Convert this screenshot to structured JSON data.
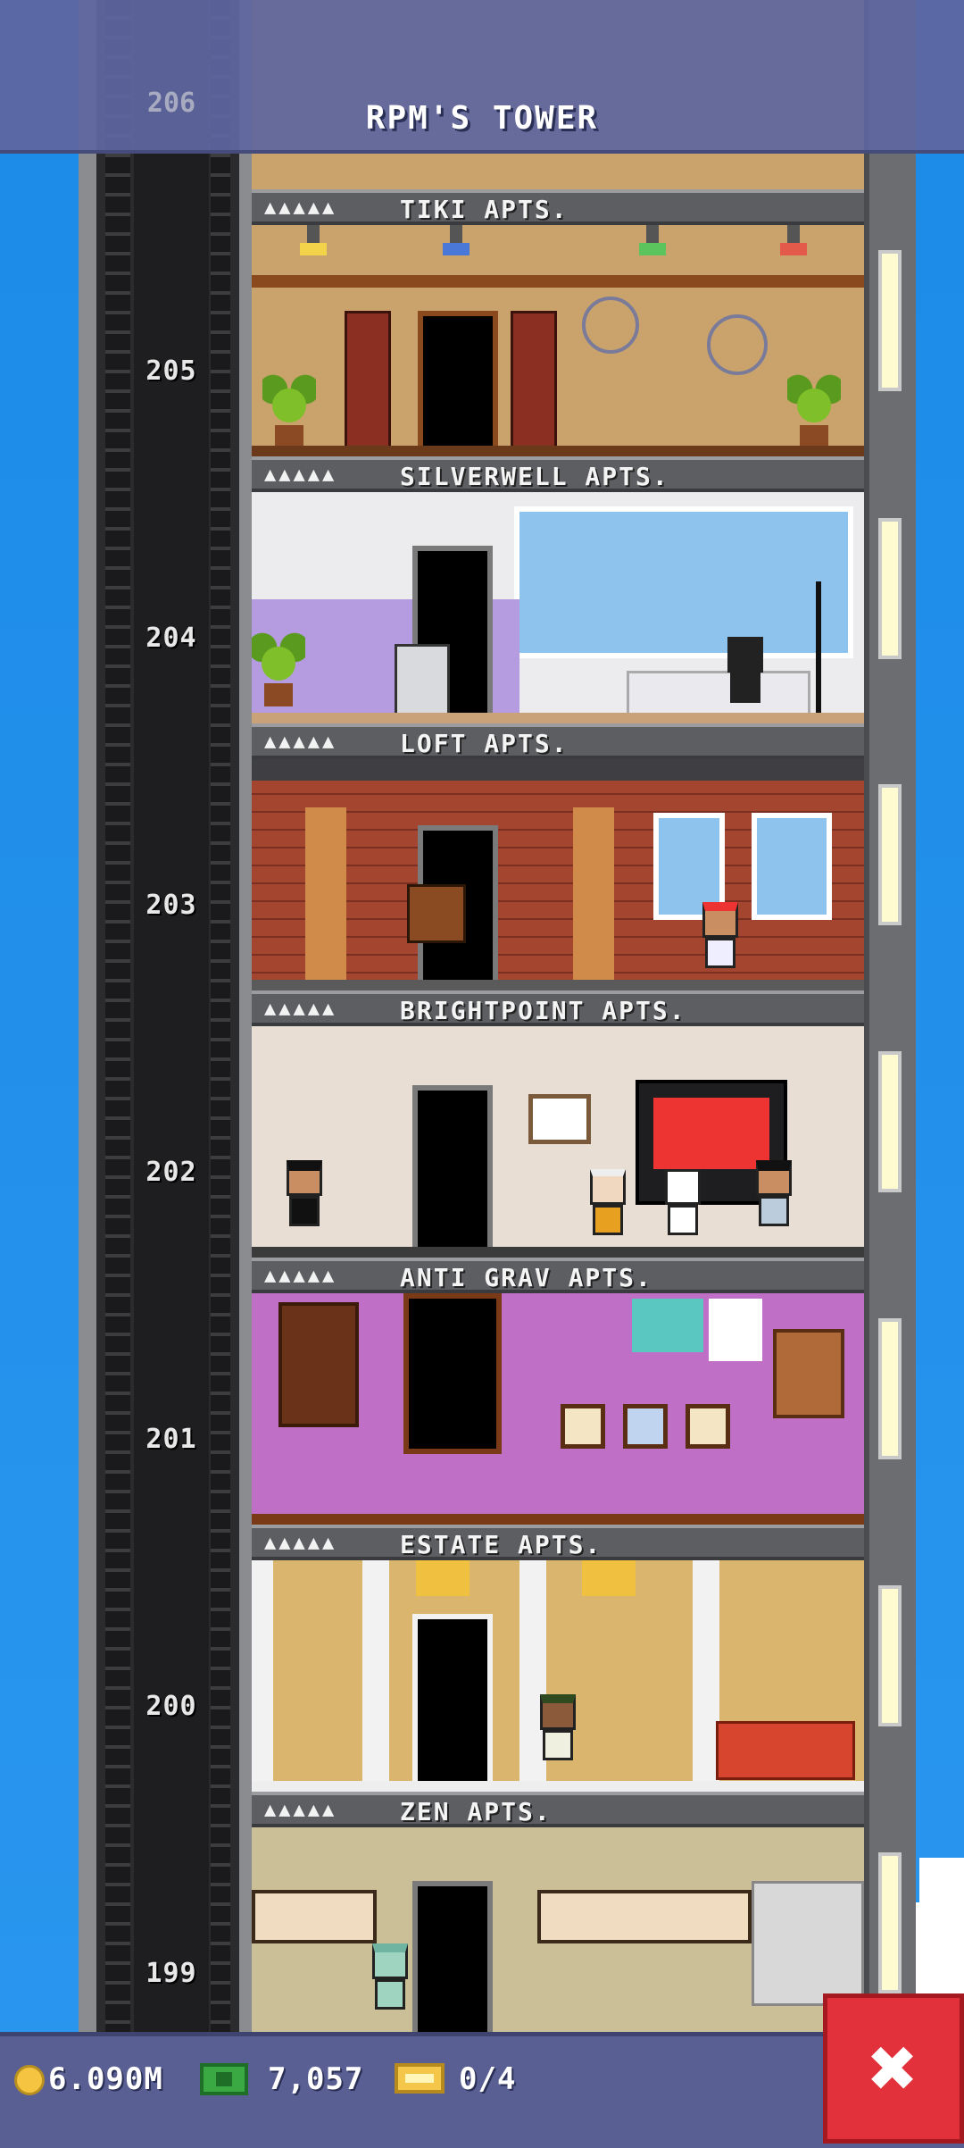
{
  "header": {
    "title": "RPM'S TOWER",
    "top_floor_number": "206"
  },
  "floors": [
    {
      "number": "205",
      "name": "TIKI APTS.",
      "stars": "▲▲▲▲▲",
      "wall_color": "#c9a36b"
    },
    {
      "number": "204",
      "name": "SILVERWELL APTS.",
      "stars": "▲▲▲▲▲",
      "wall_color": "#ecebee"
    },
    {
      "number": "203",
      "name": "LOFT APTS.",
      "stars": "▲▲▲▲▲",
      "wall_color": "#a3452f"
    },
    {
      "number": "202",
      "name": "BRIGHTPOINT APTS.",
      "stars": "▲▲▲▲▲",
      "wall_color": "#e9ded3"
    },
    {
      "number": "201",
      "name": "ANTI GRAV APTS.",
      "stars": "▲▲▲▲▲",
      "wall_color": "#c06fc7"
    },
    {
      "number": "200",
      "name": "ESTATE APTS.",
      "stars": "▲▲▲▲▲",
      "wall_color": "#d9b56d"
    },
    {
      "number": "199",
      "name": "ZEN APTS.",
      "stars": "▲▲▲▲▲",
      "wall_color": "#cbbf98"
    }
  ],
  "status_bar": {
    "coins": "6.090M",
    "bux": "7,057",
    "tickets": "0/4"
  },
  "close_button": {
    "label": "✖"
  },
  "colors": {
    "sky": "#1f8ee6",
    "bar": "#5a5f93",
    "close": "#e2313a"
  }
}
